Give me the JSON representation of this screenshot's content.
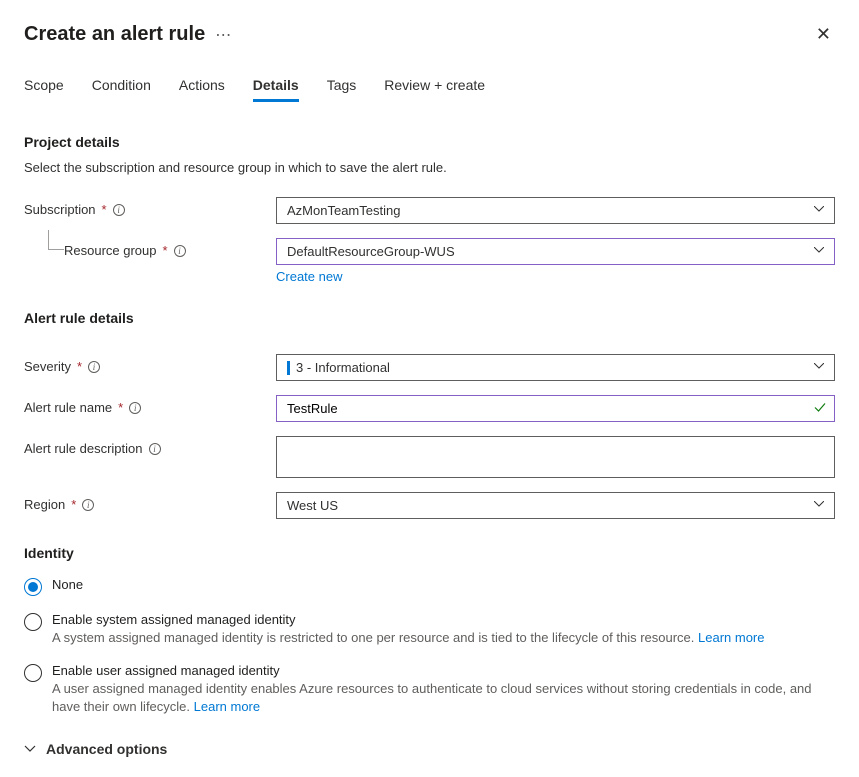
{
  "header": {
    "title": "Create an alert rule"
  },
  "tabs": {
    "items": [
      "Scope",
      "Condition",
      "Actions",
      "Details",
      "Tags",
      "Review + create"
    ],
    "active_index": 3
  },
  "project_details": {
    "heading": "Project details",
    "helper": "Select the subscription and resource group in which to save the alert rule.",
    "subscription_label": "Subscription",
    "subscription_value": "AzMonTeamTesting",
    "resource_group_label": "Resource group",
    "resource_group_value": "DefaultResourceGroup-WUS",
    "create_new_label": "Create new"
  },
  "alert_rule_details": {
    "heading": "Alert rule details",
    "severity_label": "Severity",
    "severity_value": "3 - Informational",
    "name_label": "Alert rule name",
    "name_value": "TestRule",
    "description_label": "Alert rule description",
    "description_value": "",
    "region_label": "Region",
    "region_value": "West US"
  },
  "identity": {
    "heading": "Identity",
    "options": [
      {
        "label": "None",
        "selected": true
      },
      {
        "label": "Enable system assigned managed identity",
        "description": "A system assigned managed identity is restricted to one per resource and is tied to the lifecycle of this resource.",
        "learn_more": "Learn more",
        "selected": false
      },
      {
        "label": "Enable user assigned managed identity",
        "description": "A user assigned managed identity enables Azure resources to authenticate to cloud services without storing credentials in code, and have their own lifecycle.",
        "learn_more": "Learn more",
        "selected": false
      }
    ]
  },
  "advanced": {
    "label": "Advanced options"
  }
}
